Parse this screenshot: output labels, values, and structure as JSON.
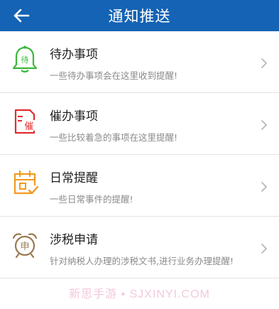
{
  "header": {
    "title": "通知推送",
    "back_icon": "arrow-left-icon"
  },
  "items": [
    {
      "label": "待办事项",
      "desc": "一些待办事项会在这里收到提醒!",
      "icon": "bell-icon",
      "icon_text": "待",
      "color": "#3bb73b"
    },
    {
      "label": "催办事项",
      "desc": "一些比较着急的事项在这里提醒!",
      "icon": "document-urge-icon",
      "icon_text": "催",
      "color": "#e02d2d"
    },
    {
      "label": "日常提醒",
      "desc": "一些日常事件的提醒!",
      "icon": "calendar-check-icon",
      "color": "#f29a1f"
    },
    {
      "label": "涉税申请",
      "desc": "针对纳税人办理的涉税文书,进行业务办理提醒!",
      "icon": "alarm-clock-icon",
      "icon_text": "申",
      "color": "#9a7a52"
    }
  ],
  "watermark": "新思手游 • SJXINYI.COM",
  "colors": {
    "header_bg": "#1463b4",
    "chevron": "#b8b8b8"
  }
}
